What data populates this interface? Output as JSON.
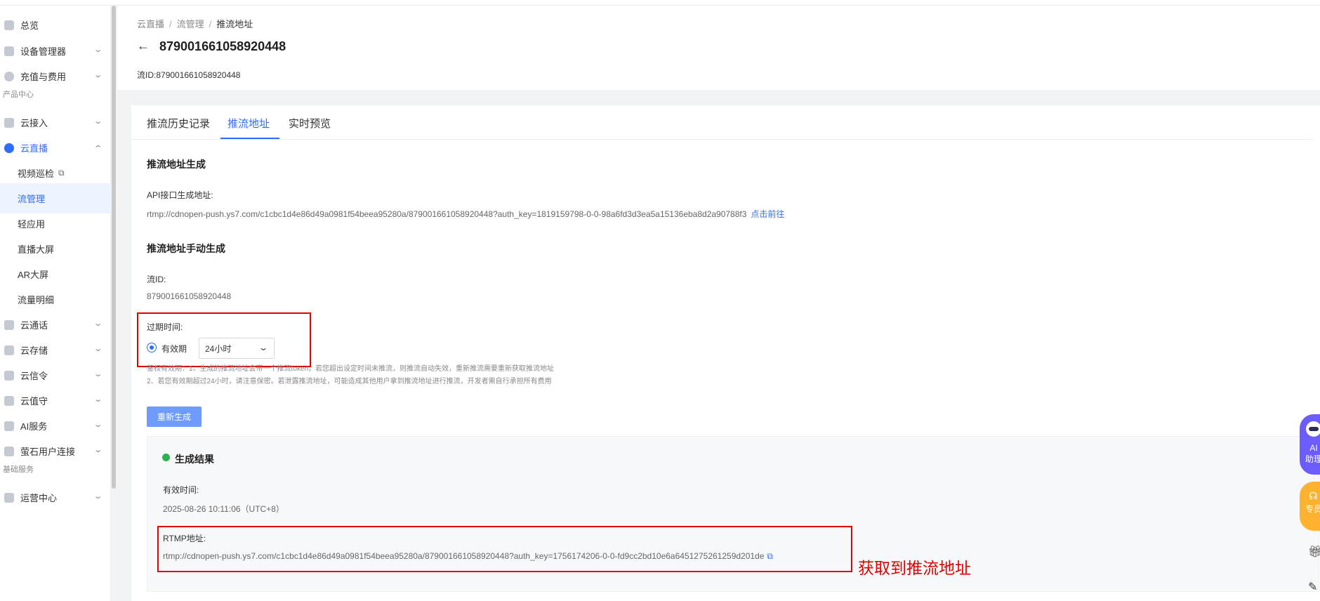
{
  "sidebar": {
    "items": [
      {
        "label": "总览",
        "chevron": false
      },
      {
        "label": "设备管理器",
        "chevron": true
      },
      {
        "label": "充值与费用",
        "chevron": true
      }
    ],
    "section_product": "产品中心",
    "product_items": [
      {
        "label": "云接入"
      },
      {
        "label": "云直播"
      }
    ],
    "live_sub": [
      {
        "label": "视频巡检"
      },
      {
        "label": "流管理"
      },
      {
        "label": "轻应用"
      },
      {
        "label": "直播大屏"
      },
      {
        "label": "AR大屏"
      },
      {
        "label": "流量明细"
      }
    ],
    "more_items": [
      {
        "label": "云通话"
      },
      {
        "label": "云存储"
      },
      {
        "label": "云信令"
      },
      {
        "label": "云值守"
      },
      {
        "label": "AI服务"
      },
      {
        "label": "萤石用户连接"
      }
    ],
    "section_basic": "基础服务",
    "basic_items": [
      {
        "label": "运营中心"
      }
    ]
  },
  "header": {
    "breadcrumb": [
      "云直播",
      "流管理",
      "推流地址"
    ],
    "title": "879001661058920448",
    "stream_id_label": "流ID:",
    "stream_id": "879001661058920448"
  },
  "tabs": [
    "推流历史记录",
    "推流地址",
    "实时预览"
  ],
  "push": {
    "section1_title": "推流地址生成",
    "api_label": "API接口生成地址:",
    "api_url": "rtmp://cdnopen-push.ys7.com/c1cbc1d4e86d49a0981f54beea95280a/879001661058920448?auth_key=1819159798-0-0-98a6fd3d3ea5a15136eba8d2a90788f3",
    "api_link": "点击前往",
    "section2_title": "推流地址手动生成",
    "stream_id_label": "流ID:",
    "stream_id": "879001661058920448",
    "expire_label": "过期时间:",
    "radio_label": "有效期",
    "select_value": "24小时",
    "hint1": "鉴权有效期：1、生成的推流地址会带一个推流token，若您超出设定时间未推流，则推流自动失效，重新推流需要重新获取推流地址",
    "hint2": "2、若您有效期超过24小时，请注意保密。若泄露推流地址，可能造成其他用户拿到推流地址进行推流，开发者需自行承担所有费用",
    "regenerate_button": "重新生成"
  },
  "result": {
    "title": "生成结果",
    "valid_label": "有效时间:",
    "valid_value": "2025-08-26 10:11:06（UTC+8）",
    "rtmp_label": "RTMP地址:",
    "rtmp_url": "rtmp://cdnopen-push.ys7.com/c1cbc1d4e86d49a0981f54beea95280a/879001661058920448?auth_key=1756174206-0-0-fd9cc2bd10e6a6451275261259d201de"
  },
  "annotation": "获取到推流地址",
  "floating": {
    "ai_line1": "AI",
    "ai_line2": "助理",
    "specialist": "专员"
  },
  "colors": {
    "accent": "#2f6bff",
    "annotation_red": "#e00000",
    "success": "#2ab34c"
  }
}
